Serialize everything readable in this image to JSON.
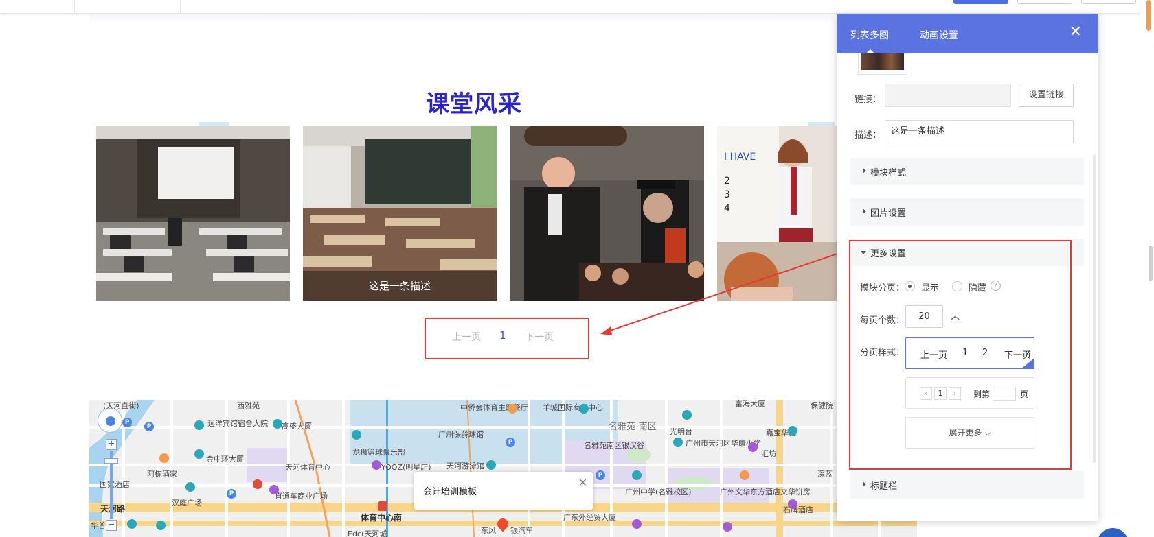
{
  "section": {
    "title": "课堂风采"
  },
  "gallery": {
    "items": [
      {
        "caption": ""
      },
      {
        "caption": "这是一条描述"
      },
      {
        "caption": ""
      },
      {
        "caption": ""
      }
    ]
  },
  "pager": {
    "prev": "上一页",
    "page": "1",
    "next": "下一页"
  },
  "map": {
    "popup_title": "会计培训模板",
    "popup_close": "✕",
    "zoom_in": "+",
    "zoom_out": "−",
    "labels": [
      "(天河直街)",
      "西雅苑",
      "远洋宾馆宿舍大院",
      "高盛大厦",
      "中侨会体育主题餐厅",
      "羊城国际商贸中心",
      "名雅苑-南区",
      "光明台",
      "富海大厦",
      "保健院",
      "广州保龄球馆",
      "龙狮篮球俱乐部",
      "名雅苑南区银汉谷",
      "广州市天河区华康小学",
      "嘉宝华庭",
      "汇坊",
      "金中环大厦",
      "阿栋酒家",
      "天河体育中心",
      "YOOZ(明星店)",
      "天河游泳馆",
      "广州中学(名雅校区)",
      "广州文华东方酒店文华饼房",
      "深蓝",
      "国家酒店",
      "汉庭广场",
      "直通车商业广场",
      "体育中心南",
      "广东外经贸大厦",
      "石牌酒店",
      "天河路",
      "华普",
      "Edc(天河城",
      "东风",
      "银汽车"
    ],
    "colors": {
      "water": "#a9d4ef",
      "road_major": "#f7d58a",
      "green": "#cfe8c9",
      "poi_zone": "#e1d8f2"
    }
  },
  "panel": {
    "tabs": [
      "列表多图",
      "动画设置"
    ],
    "close": "✕",
    "link_label": "链接：",
    "link_value": "",
    "set_link_button": "设置链接",
    "desc_label": "描述：",
    "desc_value": "这是一条描述",
    "sections": {
      "module_style": "模块样式",
      "image_settings": "图片设置",
      "more_settings": "更多设置",
      "title_bar": "标题栏"
    },
    "paging": {
      "label": "模块分页：",
      "show": "显示",
      "hide": "隐藏",
      "help": "?",
      "selected": "显示"
    },
    "per_page": {
      "label": "每页个数：",
      "value": "20",
      "unit": "个"
    },
    "pager_style": {
      "label": "分页样式：",
      "option1": {
        "prev": "上一页",
        "p1": "1",
        "p2": "2",
        "next": "下一页",
        "check": "✓"
      },
      "option2": {
        "prev_icon": "‹",
        "page": "1",
        "next_icon": "›",
        "goto": "到第",
        "page_unit": "页"
      },
      "expand": "展开更多 ⌵"
    },
    "accent_color": "#5b73e0"
  },
  "annotation_color": "#e53935"
}
